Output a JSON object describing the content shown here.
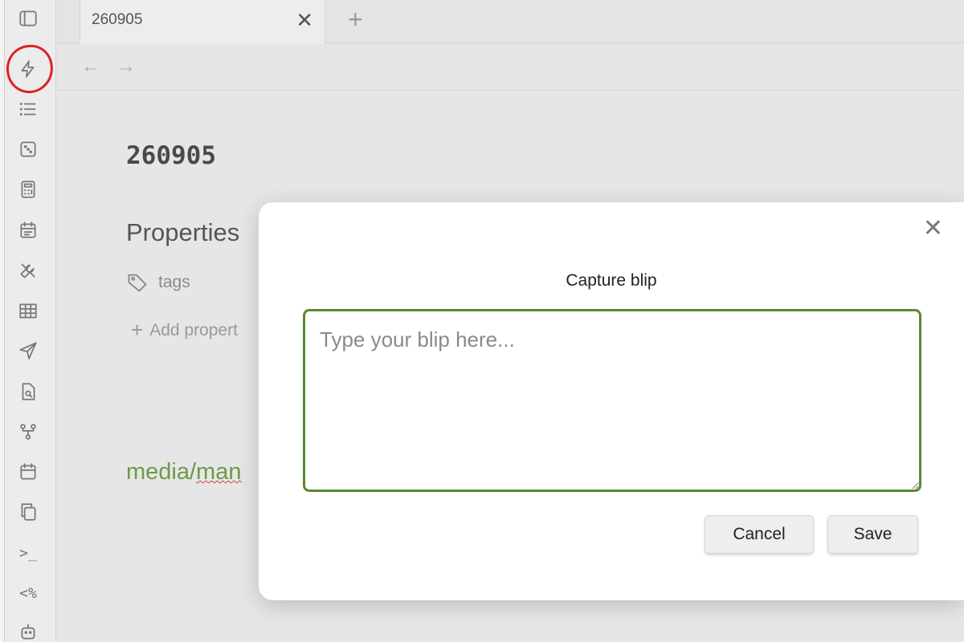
{
  "tab": {
    "title": "260905",
    "close_symbol": "✕",
    "new_symbol": "+"
  },
  "nav": {
    "back": "←",
    "forward": "→"
  },
  "ribbon": {
    "icons": [
      "sidebar-toggle-icon",
      "lightning-icon",
      "list-icon",
      "dice-icon",
      "calculator-icon",
      "calendar-icon",
      "tools-icon",
      "table-icon",
      "send-icon",
      "file-search-icon",
      "graph-icon",
      "calendar-icon",
      "copy-icon",
      "terminal-icon",
      "template-icon",
      "bot-icon"
    ],
    "terminal_label": ">_",
    "template_label": "<%"
  },
  "note": {
    "title": "260905",
    "properties_heading": "Properties",
    "tags_label": "tags",
    "add_property_label": "Add propert",
    "media_link_prefix": "media/",
    "media_link_rest": "man"
  },
  "modal": {
    "title": "Capture blip",
    "close_symbol": "✕",
    "input_placeholder": "Type your blip here...",
    "input_value": "",
    "cancel_label": "Cancel",
    "save_label": "Save",
    "accent_color": "#5a8a32"
  },
  "annotation": {
    "highlight_color": "#e02020"
  }
}
